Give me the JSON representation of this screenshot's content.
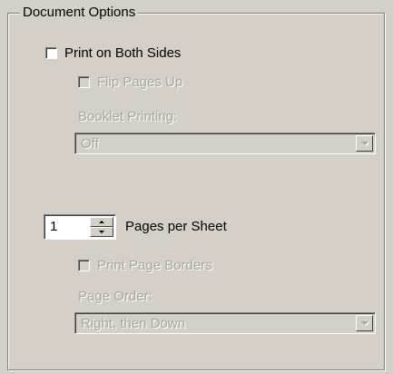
{
  "group": {
    "title": "Document Options"
  },
  "print_both_sides": {
    "label": "Print on Both Sides",
    "checked": false
  },
  "flip_pages_up": {
    "label": "Flip Pages Up",
    "checked": false,
    "enabled": false
  },
  "booklet_printing": {
    "label": "Booklet Printing:",
    "value": "Off",
    "enabled": false
  },
  "pages_per_sheet": {
    "value": "1",
    "label": "Pages per Sheet"
  },
  "print_page_borders": {
    "label": "Print Page Borders",
    "checked": false,
    "enabled": false
  },
  "page_order": {
    "label": "Page Order:",
    "value": "Right, then Down",
    "enabled": false
  },
  "colors": {
    "face": "#d4d0c8",
    "disabled_text": "#a8a6a0"
  }
}
